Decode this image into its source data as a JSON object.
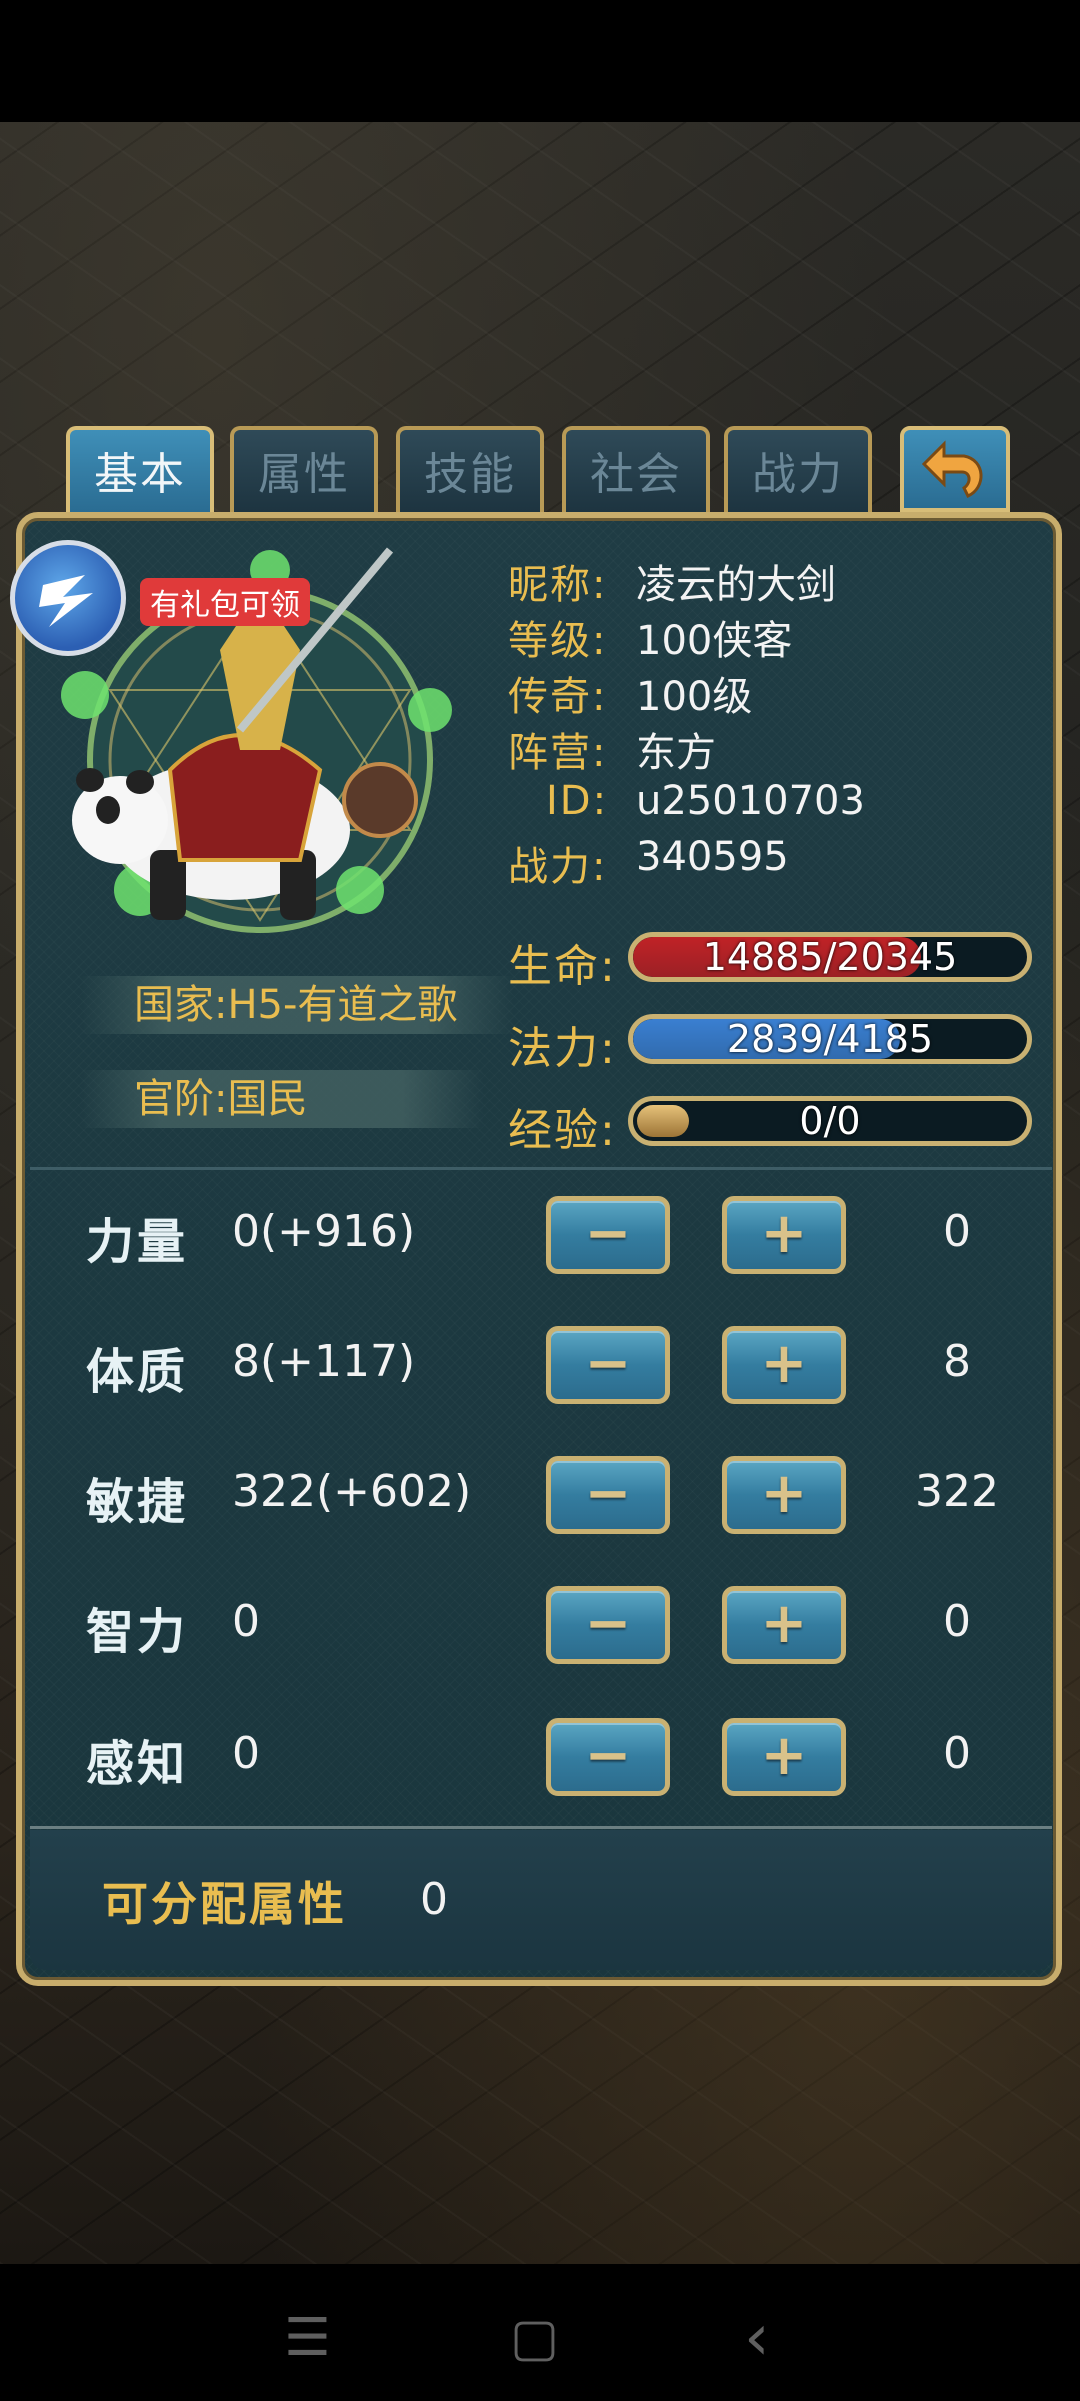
{
  "tabs": [
    "基本",
    "属性",
    "技能",
    "社会",
    "战力"
  ],
  "active_tab": 0,
  "gift_badge": "有礼包可领",
  "profile": {
    "nickname_label": "昵称:",
    "nickname": "凌云的大剑",
    "level_label": "等级:",
    "level": "100侠客",
    "legend_label": "传奇:",
    "legend": "100级",
    "camp_label": "阵营:",
    "camp": "东方",
    "id_label": "ID:",
    "id": "u25010703",
    "power_label": "战力:",
    "power": "340595"
  },
  "country": "国家:H5-有道之歌",
  "rank": "官阶:国民",
  "bars": {
    "hp": {
      "label": "生命:",
      "text": "14885/20345",
      "fraction": 0.732,
      "color": "#c02226"
    },
    "mp": {
      "label": "法力:",
      "text": "2839/4185",
      "fraction": 0.678,
      "color": "#3a7fd1"
    },
    "exp": {
      "label": "经验:",
      "text": "0/0",
      "fraction": 0.0,
      "color": "#c9a15a"
    }
  },
  "stats": [
    {
      "name": "力量",
      "value": "0(+916)",
      "allocated": "0"
    },
    {
      "name": "体质",
      "value": "8(+117)",
      "allocated": "8"
    },
    {
      "name": "敏捷",
      "value": "322(+602)",
      "allocated": "322"
    },
    {
      "name": "智力",
      "value": "0",
      "allocated": "0"
    },
    {
      "name": "感知",
      "value": "0",
      "allocated": "0"
    }
  ],
  "buttons": {
    "minus": "−",
    "plus": "+"
  },
  "unallocated": {
    "label": "可分配属性",
    "value": "0"
  },
  "nav": {
    "menu": "☰",
    "home": "▢",
    "back": "‹"
  }
}
